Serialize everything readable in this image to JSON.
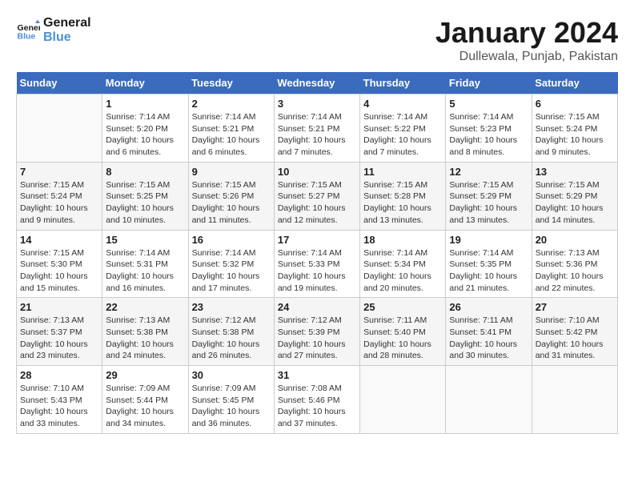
{
  "header": {
    "logo_line1": "General",
    "logo_line2": "Blue",
    "title": "January 2024",
    "subtitle": "Dullewala, Punjab, Pakistan"
  },
  "calendar": {
    "days_of_week": [
      "Sunday",
      "Monday",
      "Tuesday",
      "Wednesday",
      "Thursday",
      "Friday",
      "Saturday"
    ],
    "weeks": [
      [
        {
          "num": "",
          "info": ""
        },
        {
          "num": "1",
          "info": "Sunrise: 7:14 AM\nSunset: 5:20 PM\nDaylight: 10 hours\nand 6 minutes."
        },
        {
          "num": "2",
          "info": "Sunrise: 7:14 AM\nSunset: 5:21 PM\nDaylight: 10 hours\nand 6 minutes."
        },
        {
          "num": "3",
          "info": "Sunrise: 7:14 AM\nSunset: 5:21 PM\nDaylight: 10 hours\nand 7 minutes."
        },
        {
          "num": "4",
          "info": "Sunrise: 7:14 AM\nSunset: 5:22 PM\nDaylight: 10 hours\nand 7 minutes."
        },
        {
          "num": "5",
          "info": "Sunrise: 7:14 AM\nSunset: 5:23 PM\nDaylight: 10 hours\nand 8 minutes."
        },
        {
          "num": "6",
          "info": "Sunrise: 7:15 AM\nSunset: 5:24 PM\nDaylight: 10 hours\nand 9 minutes."
        }
      ],
      [
        {
          "num": "7",
          "info": "Sunrise: 7:15 AM\nSunset: 5:24 PM\nDaylight: 10 hours\nand 9 minutes."
        },
        {
          "num": "8",
          "info": "Sunrise: 7:15 AM\nSunset: 5:25 PM\nDaylight: 10 hours\nand 10 minutes."
        },
        {
          "num": "9",
          "info": "Sunrise: 7:15 AM\nSunset: 5:26 PM\nDaylight: 10 hours\nand 11 minutes."
        },
        {
          "num": "10",
          "info": "Sunrise: 7:15 AM\nSunset: 5:27 PM\nDaylight: 10 hours\nand 12 minutes."
        },
        {
          "num": "11",
          "info": "Sunrise: 7:15 AM\nSunset: 5:28 PM\nDaylight: 10 hours\nand 13 minutes."
        },
        {
          "num": "12",
          "info": "Sunrise: 7:15 AM\nSunset: 5:29 PM\nDaylight: 10 hours\nand 13 minutes."
        },
        {
          "num": "13",
          "info": "Sunrise: 7:15 AM\nSunset: 5:29 PM\nDaylight: 10 hours\nand 14 minutes."
        }
      ],
      [
        {
          "num": "14",
          "info": "Sunrise: 7:15 AM\nSunset: 5:30 PM\nDaylight: 10 hours\nand 15 minutes."
        },
        {
          "num": "15",
          "info": "Sunrise: 7:14 AM\nSunset: 5:31 PM\nDaylight: 10 hours\nand 16 minutes."
        },
        {
          "num": "16",
          "info": "Sunrise: 7:14 AM\nSunset: 5:32 PM\nDaylight: 10 hours\nand 17 minutes."
        },
        {
          "num": "17",
          "info": "Sunrise: 7:14 AM\nSunset: 5:33 PM\nDaylight: 10 hours\nand 19 minutes."
        },
        {
          "num": "18",
          "info": "Sunrise: 7:14 AM\nSunset: 5:34 PM\nDaylight: 10 hours\nand 20 minutes."
        },
        {
          "num": "19",
          "info": "Sunrise: 7:14 AM\nSunset: 5:35 PM\nDaylight: 10 hours\nand 21 minutes."
        },
        {
          "num": "20",
          "info": "Sunrise: 7:13 AM\nSunset: 5:36 PM\nDaylight: 10 hours\nand 22 minutes."
        }
      ],
      [
        {
          "num": "21",
          "info": "Sunrise: 7:13 AM\nSunset: 5:37 PM\nDaylight: 10 hours\nand 23 minutes."
        },
        {
          "num": "22",
          "info": "Sunrise: 7:13 AM\nSunset: 5:38 PM\nDaylight: 10 hours\nand 24 minutes."
        },
        {
          "num": "23",
          "info": "Sunrise: 7:12 AM\nSunset: 5:38 PM\nDaylight: 10 hours\nand 26 minutes."
        },
        {
          "num": "24",
          "info": "Sunrise: 7:12 AM\nSunset: 5:39 PM\nDaylight: 10 hours\nand 27 minutes."
        },
        {
          "num": "25",
          "info": "Sunrise: 7:11 AM\nSunset: 5:40 PM\nDaylight: 10 hours\nand 28 minutes."
        },
        {
          "num": "26",
          "info": "Sunrise: 7:11 AM\nSunset: 5:41 PM\nDaylight: 10 hours\nand 30 minutes."
        },
        {
          "num": "27",
          "info": "Sunrise: 7:10 AM\nSunset: 5:42 PM\nDaylight: 10 hours\nand 31 minutes."
        }
      ],
      [
        {
          "num": "28",
          "info": "Sunrise: 7:10 AM\nSunset: 5:43 PM\nDaylight: 10 hours\nand 33 minutes."
        },
        {
          "num": "29",
          "info": "Sunrise: 7:09 AM\nSunset: 5:44 PM\nDaylight: 10 hours\nand 34 minutes."
        },
        {
          "num": "30",
          "info": "Sunrise: 7:09 AM\nSunset: 5:45 PM\nDaylight: 10 hours\nand 36 minutes."
        },
        {
          "num": "31",
          "info": "Sunrise: 7:08 AM\nSunset: 5:46 PM\nDaylight: 10 hours\nand 37 minutes."
        },
        {
          "num": "",
          "info": ""
        },
        {
          "num": "",
          "info": ""
        },
        {
          "num": "",
          "info": ""
        }
      ]
    ]
  }
}
